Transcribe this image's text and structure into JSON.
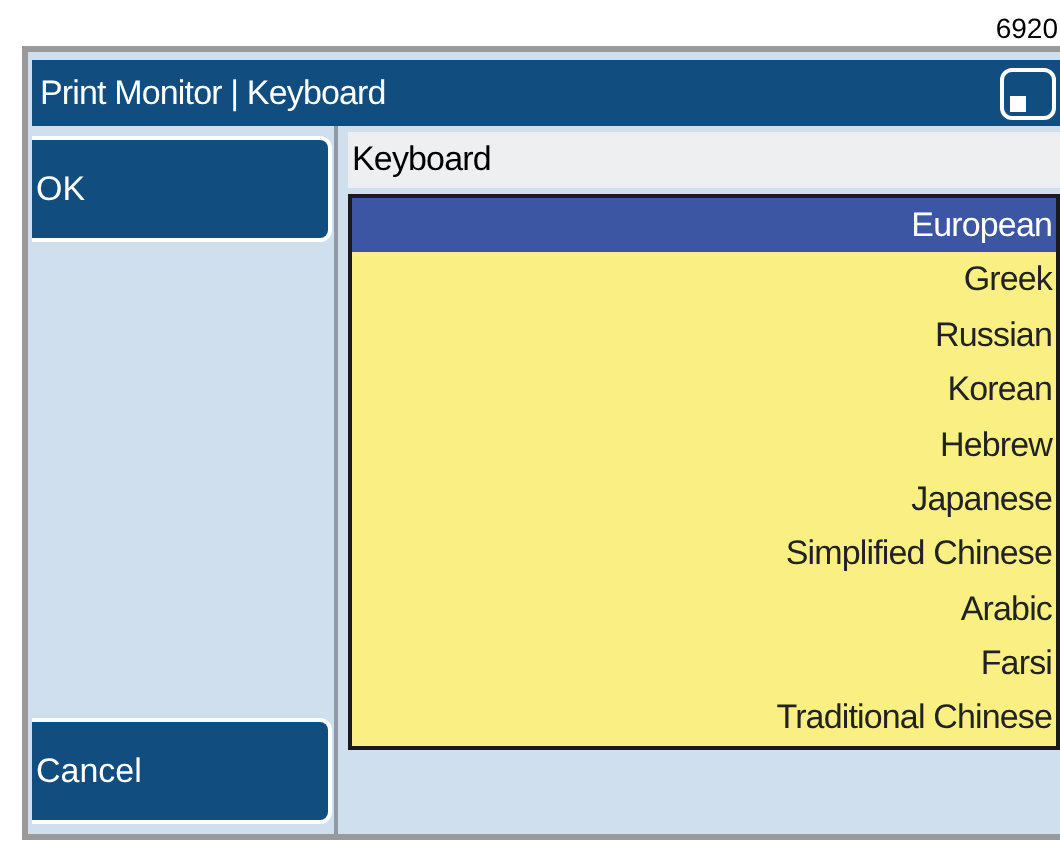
{
  "figure_number": "6920",
  "window": {
    "title": "Print Monitor | Keyboard"
  },
  "buttons": [
    {
      "label": "OK"
    },
    {
      "label": "Cancel"
    }
  ],
  "panel": {
    "title": "Keyboard"
  },
  "list": [
    {
      "label": "European",
      "selected": true
    },
    {
      "label": "Greek",
      "selected": false
    },
    {
      "label": "Russian",
      "selected": false
    },
    {
      "label": "Korean",
      "selected": false
    },
    {
      "label": "Hebrew",
      "selected": false
    },
    {
      "label": "Japanese",
      "selected": false
    },
    {
      "label": "Simplified Chinese",
      "selected": false
    },
    {
      "label": "Arabic",
      "selected": false
    },
    {
      "label": "Farsi",
      "selected": false
    },
    {
      "label": "Traditional Chinese",
      "selected": false
    }
  ]
}
